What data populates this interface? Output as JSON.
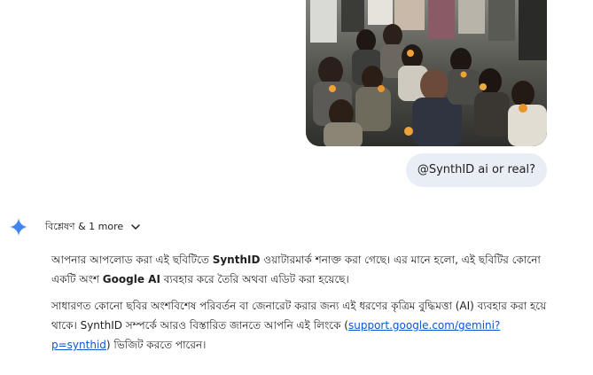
{
  "user_query": {
    "text": "@SynthID ai or real?"
  },
  "response": {
    "analysis_toggle_label": "বিশ্লেষণ & 1 more",
    "para1": {
      "before": "আপনার আপলোড করা এই ছবিটিতে ",
      "bold1": "SynthID",
      "middle": " ওয়াটারমার্ক শনাক্ত করা গেছে। এর মানে হলো, এই ছবিটির কোনো একটি অংশ ",
      "bold2": "Google AI",
      "after": " ব্যবহার করে তৈরি অথবা এডিট করা হয়েছে।"
    },
    "para2": {
      "before": "সাধারণত কোনো ছবির অংশবিশেষ পরিবর্তন বা জেনারেট করার জন্য এই ধরণের কৃত্রিম বুদ্ধিমত্তা (AI) ব্যবহার করা হয়ে থাকে। SynthID সম্পর্কে আরও বিস্তারিত জানতে আপনি এই লিংকে (",
      "link": "support.google.com/gemini?p=synthid",
      "after": ") ভিজিট করতে পারেন।"
    }
  },
  "colors": {
    "bubble_bg": "#e9eef6",
    "link": "#0b57d0",
    "spark": "#4285f4"
  },
  "icons": {
    "spark": "gemini-spark-icon",
    "chevron": "chevron-down-icon"
  }
}
